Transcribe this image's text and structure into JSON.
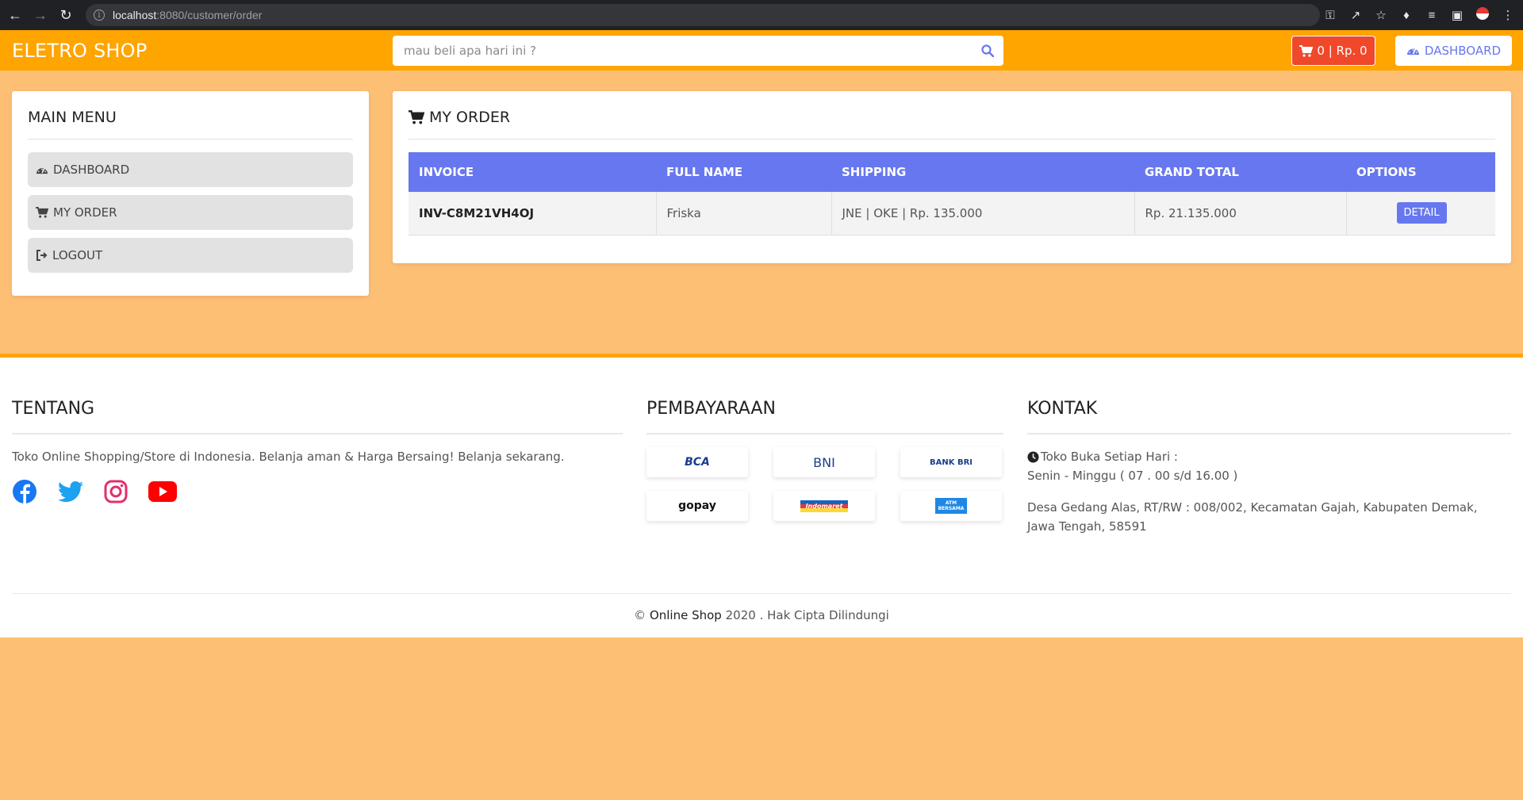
{
  "browser": {
    "url_host": "localhost",
    "url_path": ":8080/customer/order"
  },
  "header": {
    "brand": "ELETRO SHOP",
    "search_placeholder": "mau beli apa hari ini ?",
    "cart_label": "0 | Rp. 0",
    "dashboard_label": "DASHBOARD"
  },
  "sidebar": {
    "title": "MAIN MENU",
    "items": [
      {
        "label": "DASHBOARD",
        "icon": "dashboard-icon"
      },
      {
        "label": "MY ORDER",
        "icon": "cart-icon"
      },
      {
        "label": "LOGOUT",
        "icon": "logout-icon"
      }
    ]
  },
  "orders": {
    "title": "MY ORDER",
    "columns": [
      "INVOICE",
      "FULL NAME",
      "SHIPPING",
      "GRAND TOTAL",
      "OPTIONS"
    ],
    "rows": [
      {
        "invoice": "INV-C8M21VH4OJ",
        "full_name": "Friska",
        "shipping": "JNE | OKE | Rp. 135.000",
        "grand_total": "Rp. 21.135.000",
        "option_label": "DETAIL"
      }
    ]
  },
  "footer": {
    "tentang": {
      "title": "TENTANG",
      "text": "Toko Online Shopping/Store di Indonesia. Belanja aman & Harga Bersaing! Belanja sekarang."
    },
    "pembayaran": {
      "title": "PEMBAYARAAN",
      "methods": [
        "BCA",
        "BNI",
        "BANK BRI",
        "gopay",
        "Indomaret",
        "ATM BERSAMA"
      ]
    },
    "kontak": {
      "title": "KONTAK",
      "hours_label": "Toko Buka Setiap Hari :",
      "hours": "Senin - Minggu ( 07 . 00 s/d 16.00 )",
      "address": "Desa Gedang Alas, RT/RW : 008/002, Kecamatan Gajah, Kabupaten Demak, Jawa Tengah, 58591"
    },
    "copyright_prefix": "©",
    "copyright_brand": "Online Shop",
    "copyright_suffix": "2020 . Hak Cipta Dilindungi"
  },
  "colors": {
    "primary": "#6777ef",
    "header": "#ffa500",
    "background": "#fdbf74",
    "cart": "#f0482a"
  }
}
